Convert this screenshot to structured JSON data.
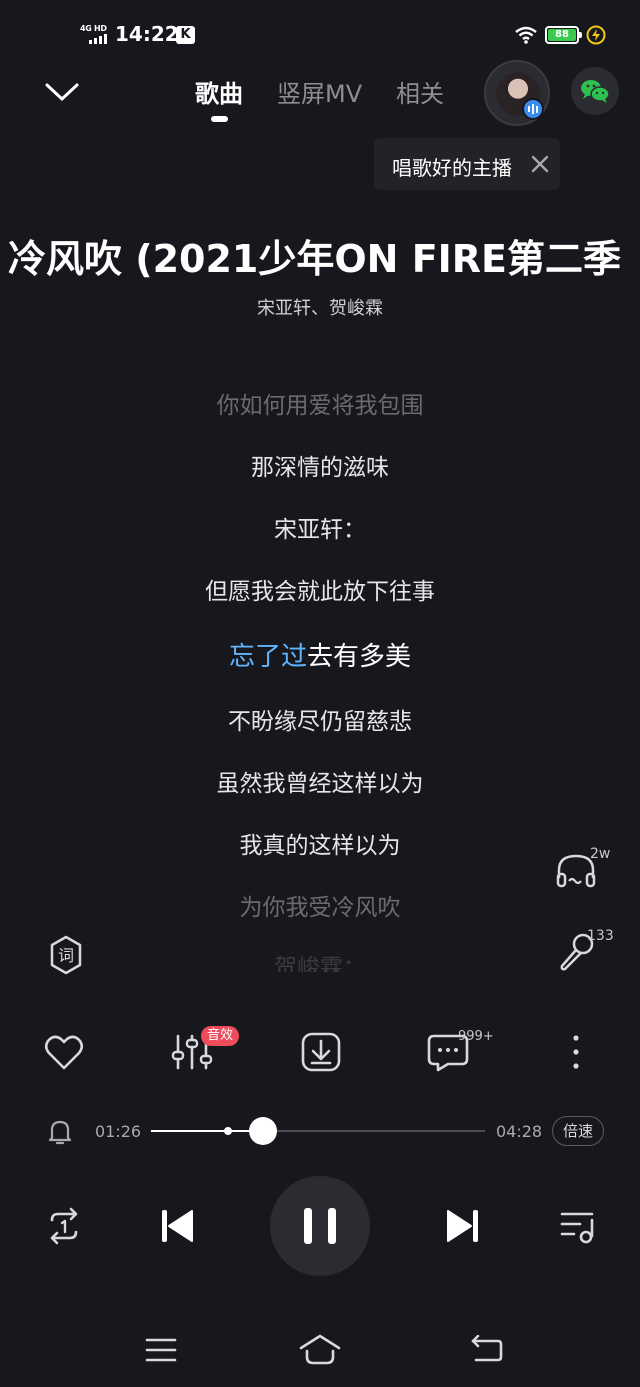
{
  "status_bar": {
    "network": "4G HD",
    "time": "14:22",
    "app_badge": "K",
    "battery": "88"
  },
  "header": {
    "tabs": [
      {
        "label": "歌曲",
        "active": true
      },
      {
        "label": "竖屏MV",
        "active": false
      },
      {
        "label": "相关",
        "active": false
      }
    ],
    "tip_text": "唱歌好的主播"
  },
  "song": {
    "title": "冷风吹 (2021少年ON FIRE第二季",
    "artist": "宋亚轩、贺峻霖"
  },
  "lyrics": [
    {
      "text": "你如何用爱将我包围",
      "state": "dim"
    },
    {
      "text": "那深情的滋味",
      "state": "normal"
    },
    {
      "text": "宋亚轩：",
      "state": "normal"
    },
    {
      "text": "但愿我会就此放下往事",
      "state": "normal"
    },
    {
      "sung": "忘了过",
      "rest": "去有多美",
      "state": "current"
    },
    {
      "text": "不盼缘尽仍留慈悲",
      "state": "normal"
    },
    {
      "text": "虽然我曾经这样以为",
      "state": "normal"
    },
    {
      "text": "我真的这样以为",
      "state": "normal"
    },
    {
      "text": "为你我受冷风吹",
      "state": "dim"
    },
    {
      "text": "贺峻霖：",
      "state": "fade"
    }
  ],
  "side": {
    "listen_count": "2w",
    "sing_count": "133",
    "lyric_btn": "词"
  },
  "actions": {
    "effect_badge": "音效",
    "comment_count": "999+"
  },
  "progress": {
    "current": "01:26",
    "total": "04:28",
    "fraction": 0.335,
    "speed_label": "倍速"
  }
}
